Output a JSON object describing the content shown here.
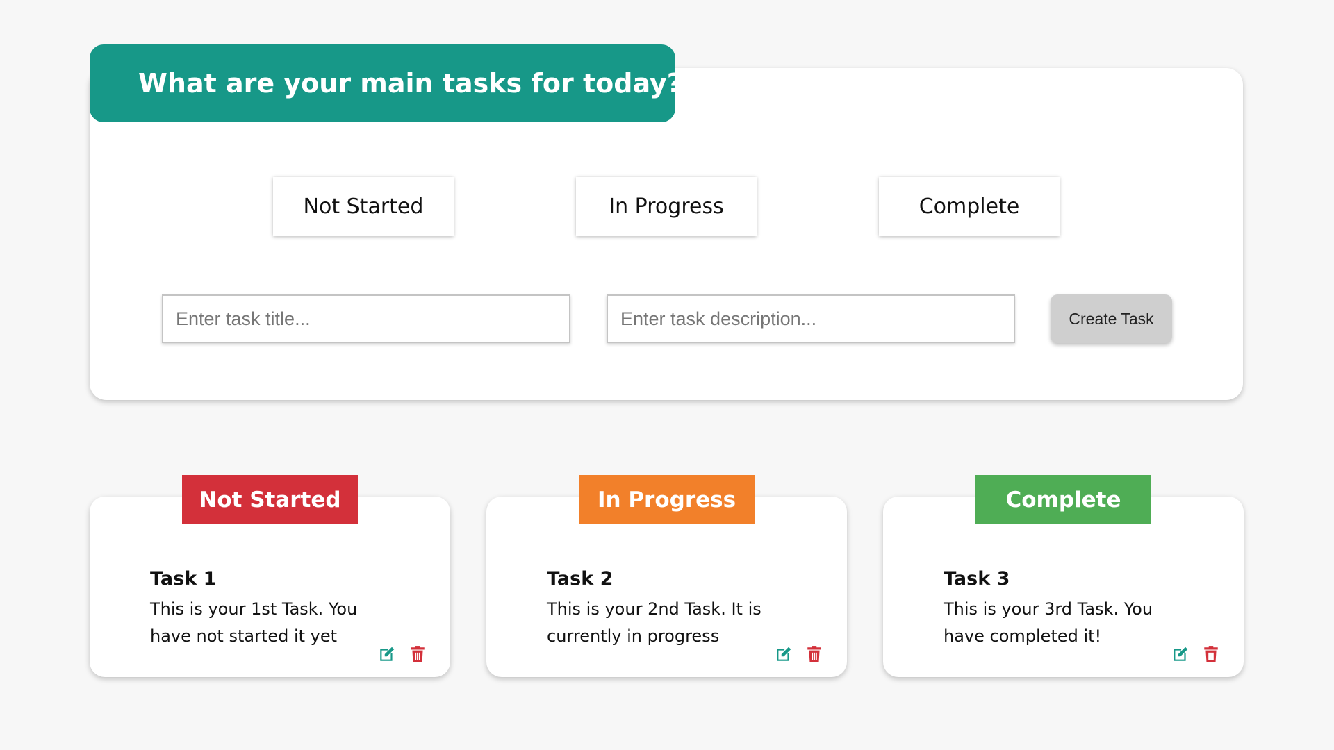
{
  "header": {
    "title": "What are your main tasks for today?"
  },
  "filters": [
    {
      "label": "Not Started"
    },
    {
      "label": "In Progress"
    },
    {
      "label": "Complete"
    }
  ],
  "form": {
    "title_placeholder": "Enter task title...",
    "title_value": "",
    "description_placeholder": "Enter task description...",
    "description_value": "",
    "create_label": "Create Task"
  },
  "colors": {
    "header_bg": "#179888",
    "not_started": "#d3303a",
    "in_progress": "#f2802a",
    "complete": "#4fad55",
    "edit_icon": "#179888",
    "delete_icon": "#d3303a"
  },
  "tasks": [
    {
      "status": "Not Started",
      "title": "Task 1",
      "description": "This is your 1st Task. You have not started it yet",
      "edit_icon": "edit-icon",
      "delete_icon": "trash-icon"
    },
    {
      "status": "In Progress",
      "title": "Task 2",
      "description": "This is your 2nd Task. It is currently in progress",
      "edit_icon": "edit-icon",
      "delete_icon": "trash-icon"
    },
    {
      "status": "Complete",
      "title": "Task 3",
      "description": "This is your 3rd Task. You have completed it!",
      "edit_icon": "edit-icon",
      "delete_icon": "trash-icon"
    }
  ]
}
